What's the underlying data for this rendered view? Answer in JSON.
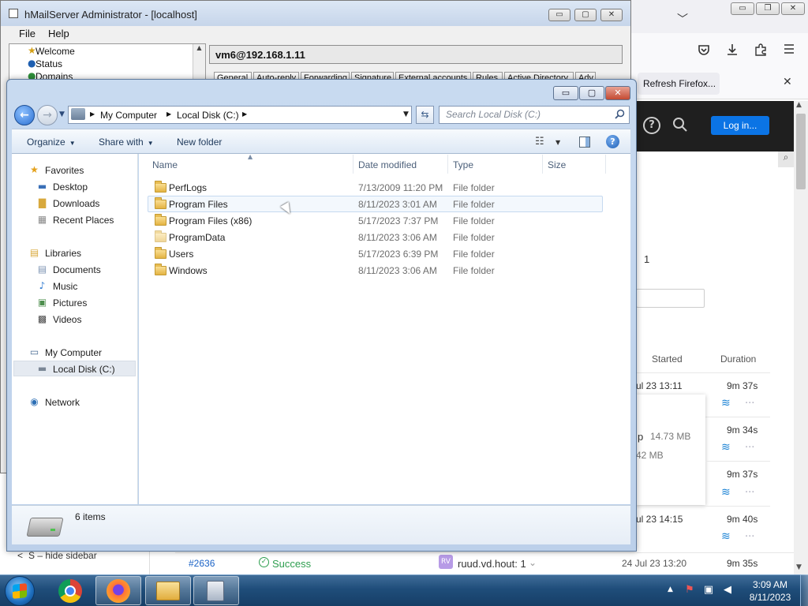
{
  "firefox": {
    "window_minimize": "▭",
    "window_maximize": "❐",
    "window_close": "✕",
    "tab_list_chevron": "﹀",
    "refresh_notice": "Refresh Firefox...",
    "login_button": "Log in...",
    "help_icon": "?",
    "content": {
      "page_number": "1",
      "col_started": "Started",
      "col_duration": "Duration",
      "runs": [
        {
          "started": "ul 23 13:11",
          "duration": "9m 37s"
        },
        {
          "started": "",
          "duration": "9m 34s"
        },
        {
          "started": "",
          "duration": "9m 37s"
        },
        {
          "started": "ul 23 14:15",
          "duration": "9m 40s"
        }
      ],
      "artifact_a_prefix": "p",
      "artifact_a_size": "14.73 MB",
      "artifact_b_size": "42 MB",
      "bottom_run": {
        "id": "#2636",
        "status": "Success",
        "avatar": "RV",
        "branch": "ruud.vd.hout: 1",
        "started": "24 Jul 23 13:20",
        "duration": "9m 35s"
      },
      "sidebar_hint": "S – hide sidebar",
      "sidebar_hint_arrow": "<"
    }
  },
  "hmail": {
    "title": "hMailServer Administrator - [localhost]",
    "menu": [
      "File",
      "Help"
    ],
    "tree": [
      "Welcome",
      "Status",
      "Domains"
    ],
    "server_label": "vm6@192.168.1.11",
    "tabs": [
      "General",
      "Auto-reply",
      "Forwarding",
      "Signature",
      "External accounts",
      "Rules",
      "Active Directory",
      "Adv"
    ],
    "window_minimize": "▭",
    "window_maximize": "▢",
    "window_close": "✕"
  },
  "explorer": {
    "window_minimize": "▭",
    "window_maximize": "▢",
    "window_close": "✕",
    "breadcrumb": [
      "My Computer",
      "Local Disk (C:)"
    ],
    "search_placeholder": "Search Local Disk (C:)",
    "commands": {
      "organize": "Organize",
      "share_with": "Share with",
      "new_folder": "New folder"
    },
    "nav": {
      "favorites": "Favorites",
      "favorites_items": [
        "Desktop",
        "Downloads",
        "Recent Places"
      ],
      "libraries": "Libraries",
      "libraries_items": [
        "Documents",
        "Music",
        "Pictures",
        "Videos"
      ],
      "computer": "My Computer",
      "computer_items": [
        "Local Disk (C:)"
      ],
      "network": "Network"
    },
    "columns": [
      "Name",
      "Date modified",
      "Type",
      "Size"
    ],
    "files": [
      {
        "name": "PerfLogs",
        "date": "7/13/2009 11:20 PM",
        "type": "File folder"
      },
      {
        "name": "Program Files",
        "date": "8/11/2023 3:01 AM",
        "type": "File folder"
      },
      {
        "name": "Program Files (x86)",
        "date": "5/17/2023 7:37 PM",
        "type": "File folder"
      },
      {
        "name": "ProgramData",
        "date": "8/11/2023 3:06 AM",
        "type": "File folder"
      },
      {
        "name": "Users",
        "date": "5/17/2023 6:39 PM",
        "type": "File folder"
      },
      {
        "name": "Windows",
        "date": "8/11/2023 3:06 AM",
        "type": "File folder"
      }
    ],
    "item_count": "6 items"
  },
  "taskbar": {
    "time": "3:09 AM",
    "date": "8/11/2023",
    "tray_up": "▲"
  }
}
